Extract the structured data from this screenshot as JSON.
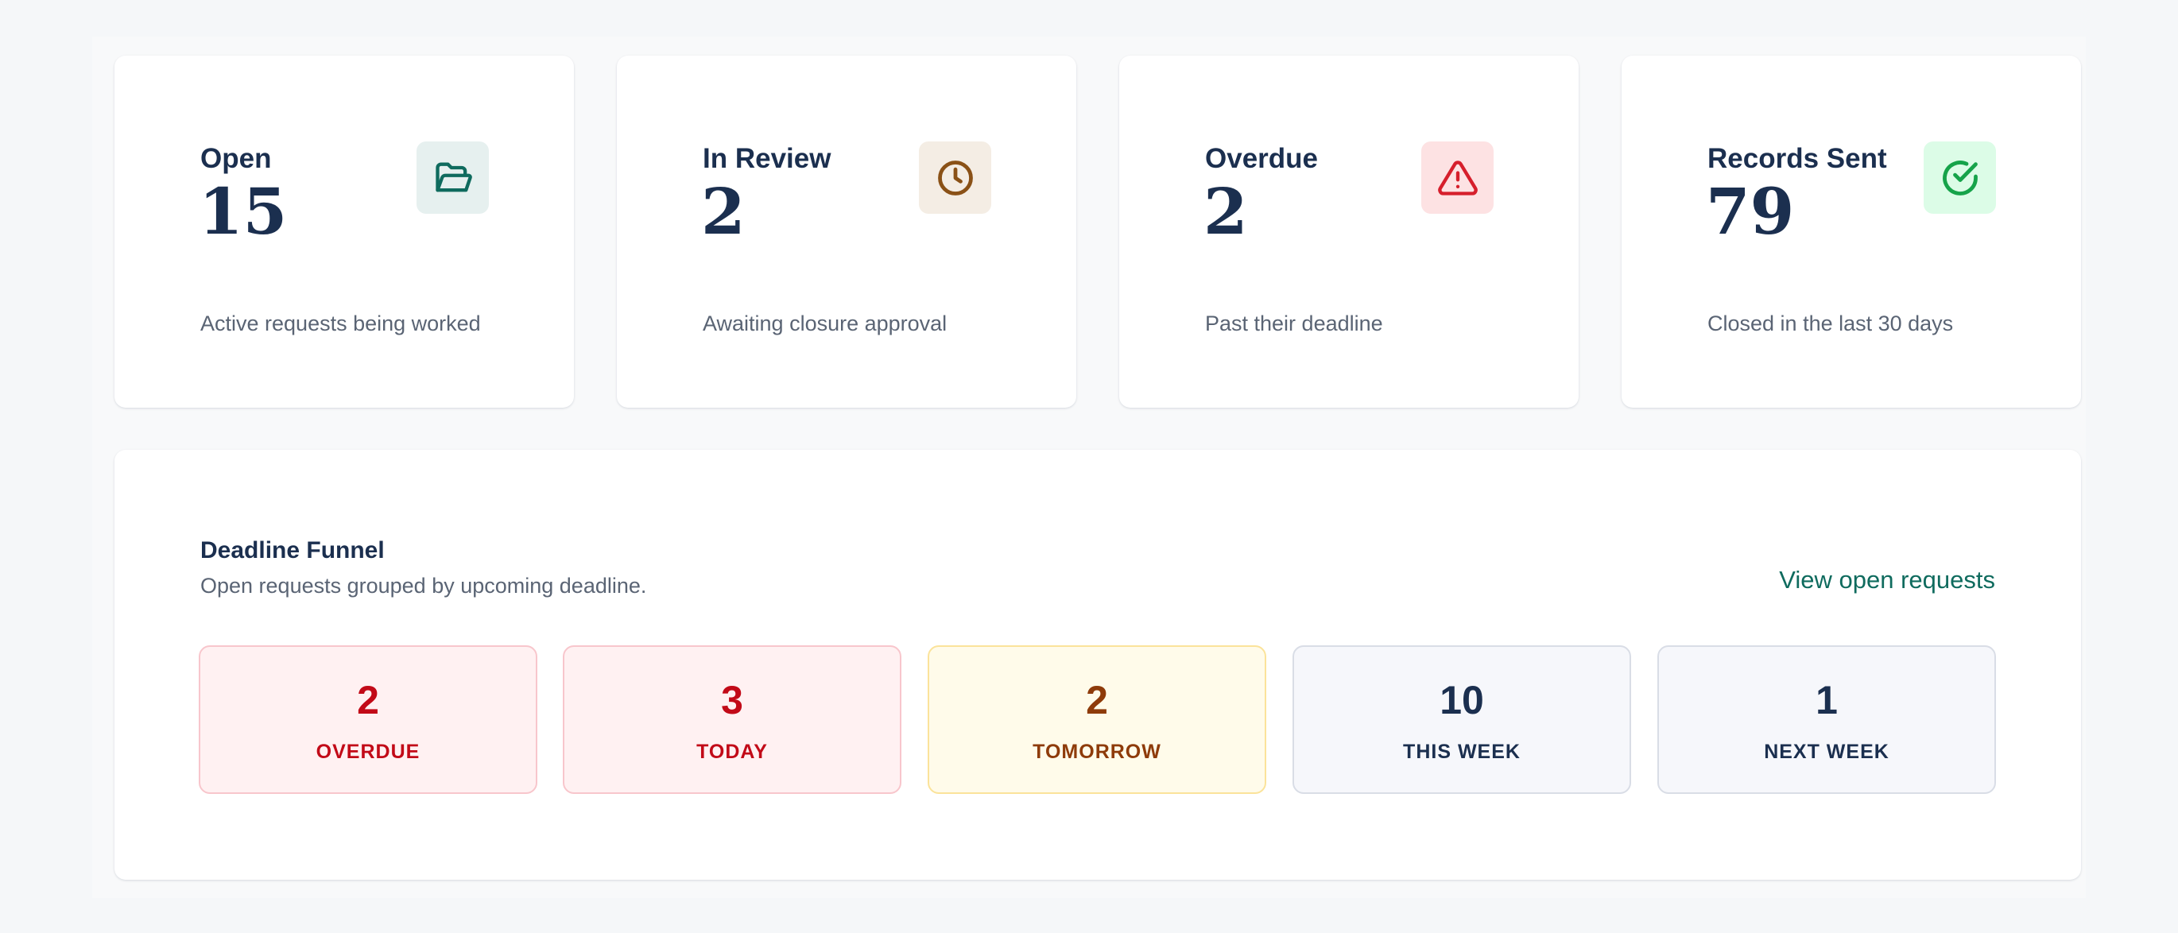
{
  "stats": [
    {
      "label": "Open",
      "value": "15",
      "description": "Active requests being worked",
      "icon": "folder-open-icon",
      "icon_color": "#0f6b5e",
      "icon_bg": "#e6f0ef"
    },
    {
      "label": "In Review",
      "value": "2",
      "description": "Awaiting closure approval",
      "icon": "clock-icon",
      "icon_color": "#8a5116",
      "icon_bg": "#f4ede4"
    },
    {
      "label": "Overdue",
      "value": "2",
      "description": "Past their deadline",
      "icon": "alert-triangle-icon",
      "icon_color": "#d61f2c",
      "icon_bg": "#fde2e3"
    },
    {
      "label": "Records Sent",
      "value": "79",
      "description": "Closed in the last 30 days",
      "icon": "check-circle-icon",
      "icon_color": "#16a34a",
      "icon_bg": "#dcfce7"
    }
  ],
  "funnel": {
    "title": "Deadline Funnel",
    "subtitle": "Open requests grouped by upcoming deadline.",
    "link_label": "View open requests",
    "buckets": [
      {
        "count": "2",
        "label": "OVERDUE",
        "tone": "red"
      },
      {
        "count": "3",
        "label": "TODAY",
        "tone": "red"
      },
      {
        "count": "2",
        "label": "TOMORROW",
        "tone": "amber"
      },
      {
        "count": "10",
        "label": "THIS WEEK",
        "tone": "gray"
      },
      {
        "count": "1",
        "label": "NEXT WEEK",
        "tone": "gray"
      }
    ]
  }
}
